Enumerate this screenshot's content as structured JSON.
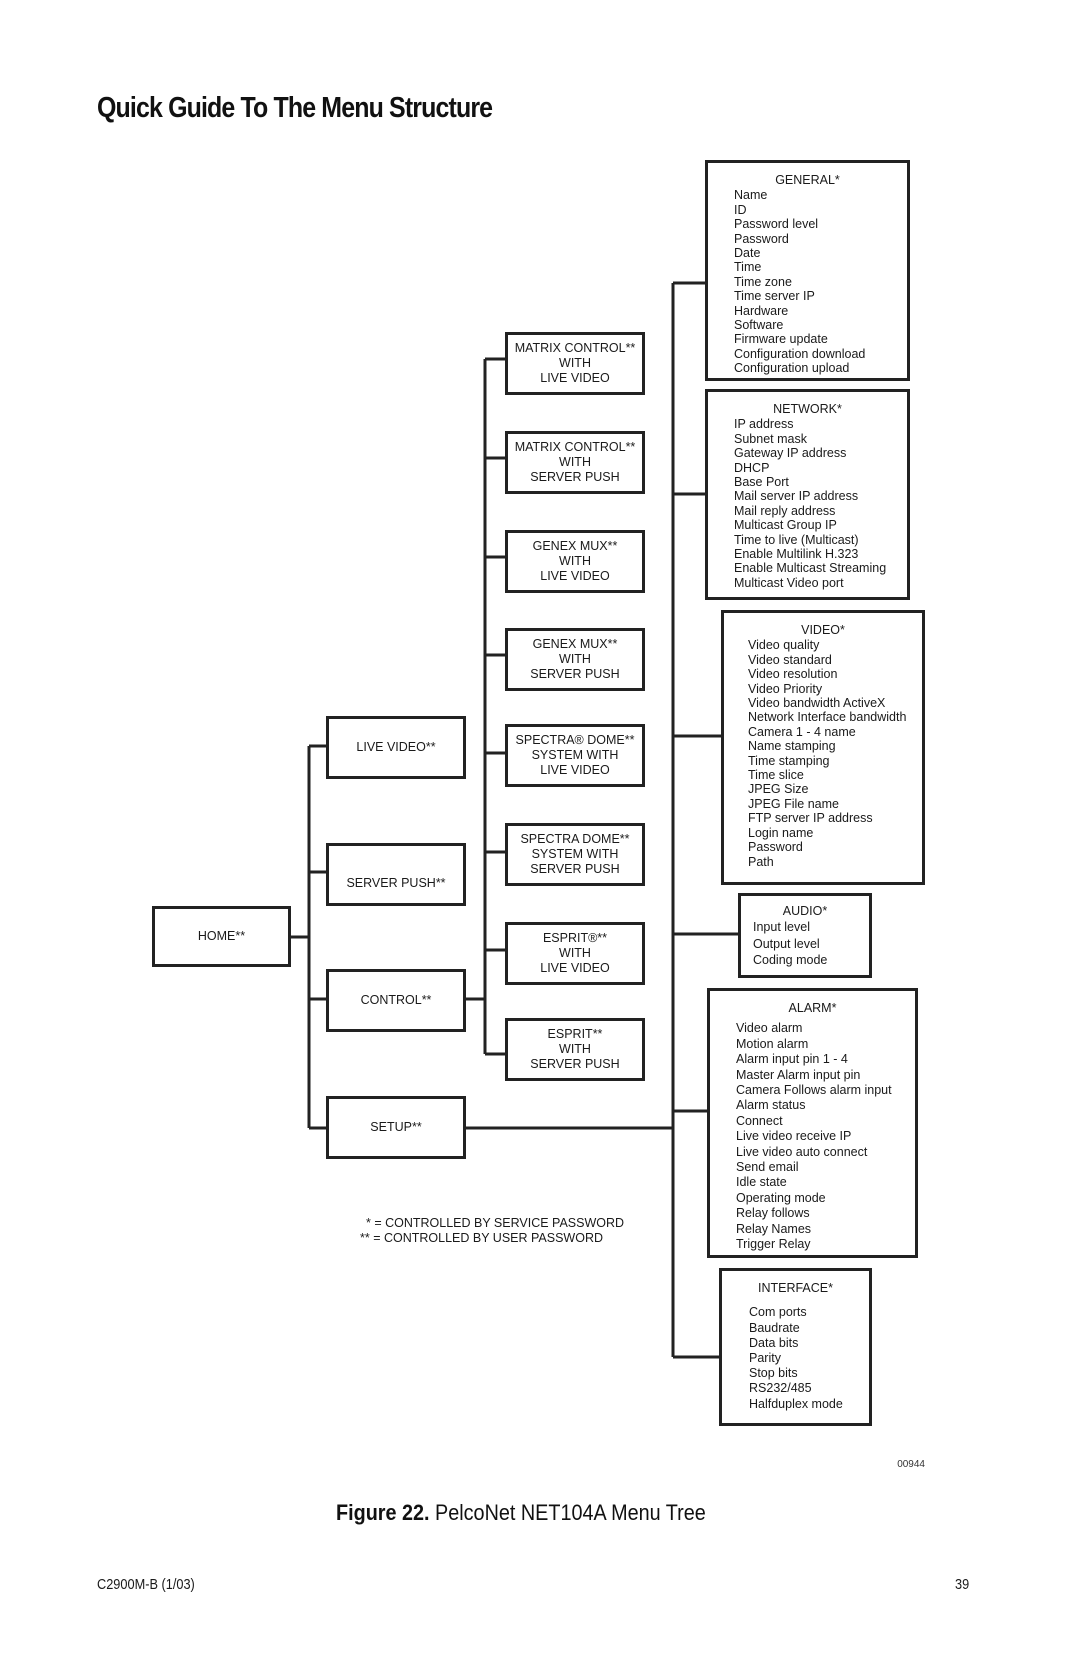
{
  "page": {
    "title": "Quick Guide To The Menu Structure",
    "figure_label": "Figure 22.",
    "figure_caption": "PelcoNet NET104A Menu Tree",
    "figure_number": "00944",
    "footer_doc": "C2900M-B (1/03)",
    "footer_page": "39"
  },
  "tree": {
    "home": "HOME**",
    "level1": [
      {
        "label": "LIVE VIDEO**"
      },
      {
        "label": "SERVER PUSH**"
      },
      {
        "label": "CONTROL**"
      },
      {
        "label": "SETUP**"
      }
    ],
    "control_children": [
      {
        "label": "MATRIX CONTROL**\nWITH\nLIVE VIDEO"
      },
      {
        "label": "MATRIX CONTROL**\nWITH\nSERVER PUSH"
      },
      {
        "label": "GENEX MUX**\nWITH\nLIVE VIDEO"
      },
      {
        "label": "GENEX MUX**\nWITH\nSERVER PUSH"
      },
      {
        "label": "SPECTRA® DOME**\nSYSTEM WITH\nLIVE VIDEO"
      },
      {
        "label": "SPECTRA DOME**\nSYSTEM WITH\nSERVER PUSH"
      },
      {
        "label": "ESPRIT®**\nWITH\nLIVE VIDEO"
      },
      {
        "label": "ESPRIT**\nWITH\nSERVER PUSH"
      }
    ],
    "setup_menus": [
      {
        "header": "GENERAL*",
        "items": [
          "Name",
          "ID",
          "Password level",
          "Password",
          "Date",
          "Time",
          "Time zone",
          "Time server IP",
          "Hardware",
          "Software",
          "Firmware update",
          "Configuration download",
          "Configuration upload"
        ]
      },
      {
        "header": "NETWORK*",
        "items": [
          "IP address",
          "Subnet mask",
          "Gateway IP address",
          "DHCP",
          "Base Port",
          "Mail server IP address",
          "Mail reply address",
          "Multicast Group IP",
          "Time to live (Multicast)",
          "Enable Multilink H.323",
          "Enable Multicast Streaming",
          "Multicast Video port"
        ]
      },
      {
        "header": "VIDEO*",
        "items": [
          "Video quality",
          "Video standard",
          "Video resolution",
          "Video Priority",
          "Video bandwidth ActiveX",
          "Network Interface bandwidth",
          "Camera 1 - 4 name",
          "Name stamping",
          "Time stamping",
          "Time slice",
          "JPEG Size",
          "JPEG File name",
          "FTP server IP address",
          "Login name",
          "Password",
          "Path"
        ]
      },
      {
        "header": "AUDIO*",
        "items": [
          "Input level",
          "Output level",
          "Coding mode"
        ]
      },
      {
        "header": "ALARM*",
        "items": [
          "Video alarm",
          "Motion alarm",
          "Alarm input pin 1 - 4",
          "Master Alarm input pin",
          "Camera Follows alarm input",
          "Alarm status",
          "Connect",
          "Live video receive IP",
          "Live video auto connect",
          "Send email",
          "Idle state",
          "Operating mode",
          "Relay follows",
          "Relay Names",
          "Trigger Relay"
        ]
      },
      {
        "header": "INTERFACE*",
        "items": [
          "Com ports",
          "Baudrate",
          "Data bits",
          "Parity",
          "Stop bits",
          "RS232/485",
          "Halfduplex mode"
        ]
      }
    ]
  },
  "legend": [
    "* = CONTROLLED BY SERVICE PASSWORD",
    "** = CONTROLLED BY USER PASSWORD"
  ]
}
